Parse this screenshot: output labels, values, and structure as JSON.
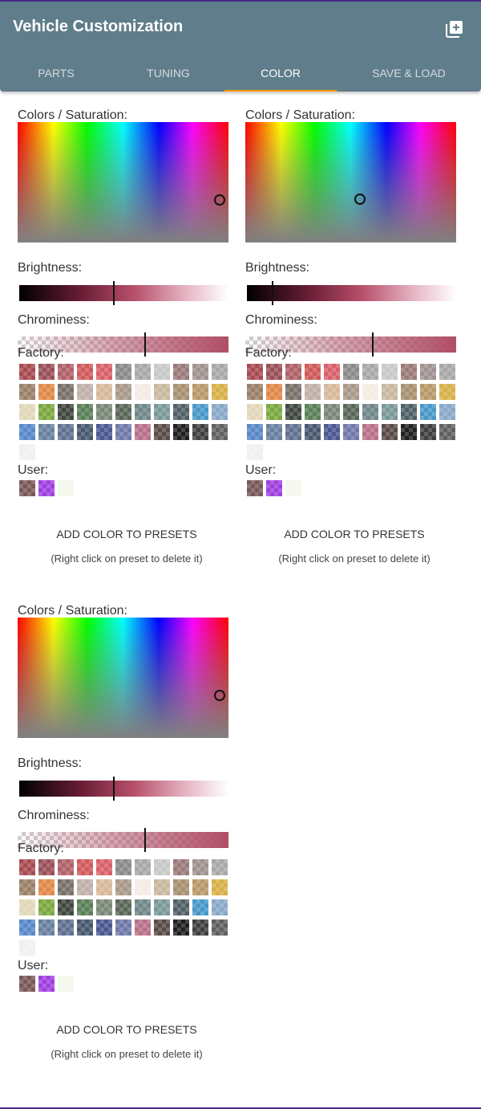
{
  "app": {
    "title": "Vehicle Customization"
  },
  "tabs": [
    {
      "label": "PARTS"
    },
    {
      "label": "TUNING"
    },
    {
      "label": "COLOR"
    },
    {
      "label": "SAVE & LOAD"
    }
  ],
  "active_tab": "COLOR",
  "labels": {
    "colors_saturation": "Colors / Saturation:",
    "brightness": "Brightness:",
    "chrominess": "Chrominess:",
    "factory": "Factory:",
    "user": "User:",
    "add_preset": "ADD COLOR TO PRESETS",
    "hint": "(Right click on preset to delete it)"
  },
  "pickers": [
    {
      "brightness": 0.45,
      "chrominess": 0.6
    },
    {
      "brightness": 0.12,
      "chrominess": 0.6
    },
    {
      "brightness": 0.45,
      "chrominess": 0.6
    }
  ],
  "factory_colors": [
    "#a84a50",
    "#9a5058",
    "#b06068",
    "#d05a5a",
    "#d8606a",
    "#8a8a8a",
    "#a8a8a8",
    "#c8c8c8",
    "#9a7a78",
    "#a09290",
    "#a8a8a8",
    "#9a8068",
    "#e08848",
    "#787068",
    "#c0b0a8",
    "#d8b89a",
    "#a89888",
    "#f4ece4",
    "#c8b8a0",
    "#a89070",
    "#b89868",
    "#d8b048",
    "#e0d8b8",
    "#7aa840",
    "#404840",
    "#5a8058",
    "#7a8878",
    "#586858",
    "#708888",
    "#7a9898",
    "#506068",
    "#4898c8",
    "#8aa8c8",
    "#5888c8",
    "#6880a0",
    "#607090",
    "#485870",
    "#4a5890",
    "#7078a8",
    "#b87088",
    "#5a4a48",
    "#202020",
    "#404040",
    "#606060",
    "#f0f0f0"
  ],
  "user_colors": [
    "#7a5858",
    "#a040e0",
    "#f4f8ec"
  ]
}
